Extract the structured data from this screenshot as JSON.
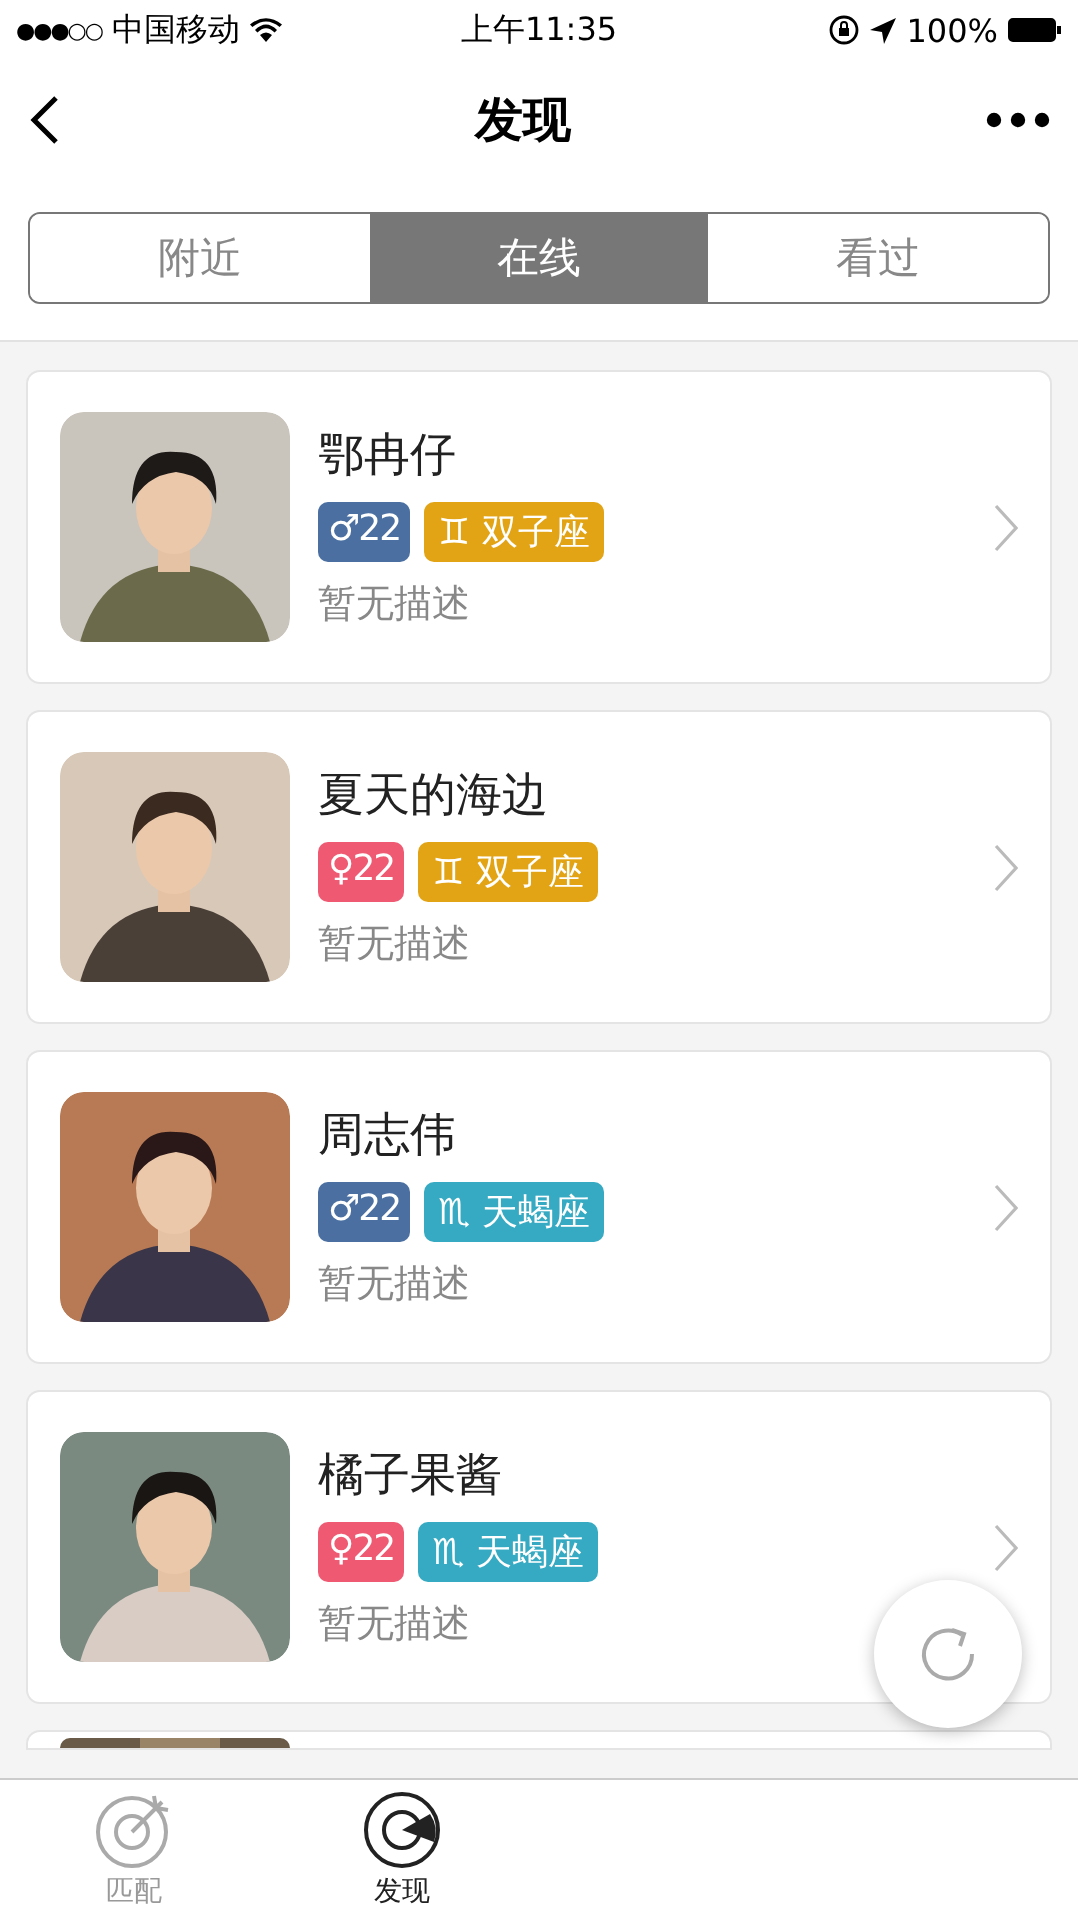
{
  "status_bar": {
    "signal": "●●●○○",
    "carrier": "中国移动",
    "time": "上午11:35",
    "battery": "100%"
  },
  "nav": {
    "title": "发现"
  },
  "segments": [
    {
      "label": "附近",
      "selected": false
    },
    {
      "label": "在线",
      "selected": true
    },
    {
      "label": "看过",
      "selected": false
    }
  ],
  "users": [
    {
      "name": "鄂冉仔",
      "tags": [
        {
          "kind": "gender",
          "symbol": "♂",
          "text": "22",
          "color": "#4a6fa0"
        },
        {
          "kind": "zodiac",
          "symbol": "♊",
          "text": "双子座",
          "color": "#e2a415"
        }
      ],
      "description": "暂无描述"
    },
    {
      "name": "夏天的海边",
      "tags": [
        {
          "kind": "gender",
          "symbol": "♀",
          "text": "22",
          "color": "#ef5a72"
        },
        {
          "kind": "zodiac",
          "symbol": "♊",
          "text": "双子座",
          "color": "#e2a415"
        }
      ],
      "description": "暂无描述"
    },
    {
      "name": "周志伟",
      "tags": [
        {
          "kind": "gender",
          "symbol": "♂",
          "text": "22",
          "color": "#4a6fa0"
        },
        {
          "kind": "zodiac",
          "symbol": "♏",
          "text": "天蝎座",
          "color": "#35aac2"
        }
      ],
      "description": "暂无描述"
    },
    {
      "name": "橘子果酱",
      "tags": [
        {
          "kind": "gender",
          "symbol": "♀",
          "text": "22",
          "color": "#ef5a72"
        },
        {
          "kind": "zodiac",
          "symbol": "♏",
          "text": "天蝎座",
          "color": "#35aac2"
        }
      ],
      "description": "暂无描述"
    }
  ],
  "tab_bar": [
    {
      "label": "匹配",
      "selected": false
    },
    {
      "label": "发现",
      "selected": true
    }
  ]
}
